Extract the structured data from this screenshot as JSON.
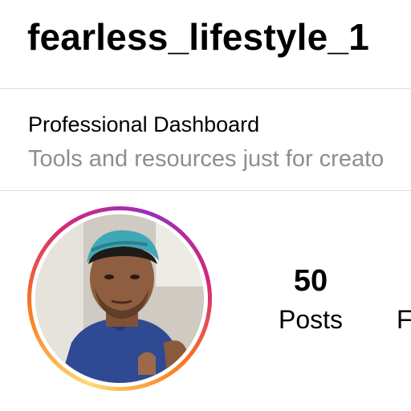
{
  "header": {
    "username": "fearless_lifestyle_1"
  },
  "dashboard": {
    "title": "Professional Dashboard",
    "subtitle": "Tools and resources just for creato"
  },
  "profile": {
    "avatar_icon": "profile-photo"
  },
  "stats": {
    "posts_count": "50",
    "posts_label": "Posts",
    "next_label_partial": "F"
  },
  "colors": {
    "ring_gradient": [
      "#feda75",
      "#fa7e1e",
      "#d62976",
      "#962fbf"
    ],
    "divider": "#dbdbdb",
    "secondary_text": "#8e8e8e"
  }
}
